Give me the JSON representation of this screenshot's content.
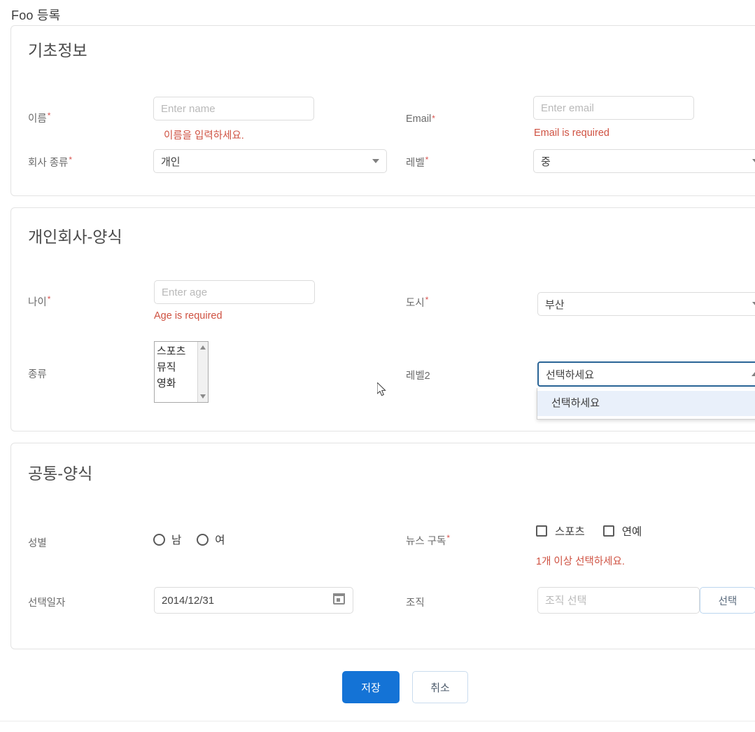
{
  "page": {
    "title": "Foo 등록"
  },
  "sections": {
    "basic": {
      "title": "기초정보",
      "name": {
        "label": "이름",
        "required_mark": "*",
        "placeholder": "Enter name",
        "value": "",
        "error": "이름을 입력하세요."
      },
      "email": {
        "label": "Email",
        "required_mark": "*",
        "placeholder": "Enter email",
        "value": "",
        "error": "Email is required"
      },
      "company_type": {
        "label": "회사 종류",
        "required_mark": "*",
        "value": "개인",
        "caret": "chevron-down-icon"
      },
      "level": {
        "label": "레벨",
        "required_mark": "*",
        "value": "중",
        "caret": "chevron-down-icon"
      }
    },
    "individual": {
      "title": "개인회사-양식",
      "age": {
        "label": "나이",
        "required_mark": "*",
        "placeholder": "Enter age",
        "value": "",
        "error": "Age is required"
      },
      "city": {
        "label": "도시",
        "required_mark": "*",
        "value": "부산",
        "caret": "chevron-down-icon"
      },
      "kind": {
        "label": "종류",
        "required_mark": "",
        "options": [
          "스포츠",
          "뮤직",
          "영화"
        ],
        "selected": []
      },
      "level2": {
        "label": "레벨2",
        "required_mark": "",
        "value": "선택하세요",
        "caret": "chevron-up-icon",
        "expanded": true,
        "options": [
          "선택하세요"
        ],
        "highlighted_option": "선택하세요"
      }
    },
    "common": {
      "title": "공통-양식",
      "gender": {
        "label": "성별",
        "required_mark": "",
        "options": [
          "남",
          "여"
        ],
        "selected": ""
      },
      "news": {
        "label": "뉴스 구독",
        "required_mark": "*",
        "options": [
          "스포츠",
          "연예"
        ],
        "selected": [],
        "error": "1개 이상 선택하세요."
      },
      "date": {
        "label": "선택일자",
        "required_mark": "",
        "value": "2014/12/31",
        "icon": "calendar-icon"
      },
      "org": {
        "label": "조직",
        "required_mark": "",
        "placeholder": "조직 선택",
        "value": "",
        "button_label": "선택"
      }
    }
  },
  "footer": {
    "save_label": "저장",
    "cancel_label": "취소"
  },
  "colors": {
    "primary": "#1473d6",
    "error": "#cf5242",
    "required": "#d9534f",
    "focus_border": "#2a6496",
    "dropdown_highlight": "#e9f0fa"
  }
}
